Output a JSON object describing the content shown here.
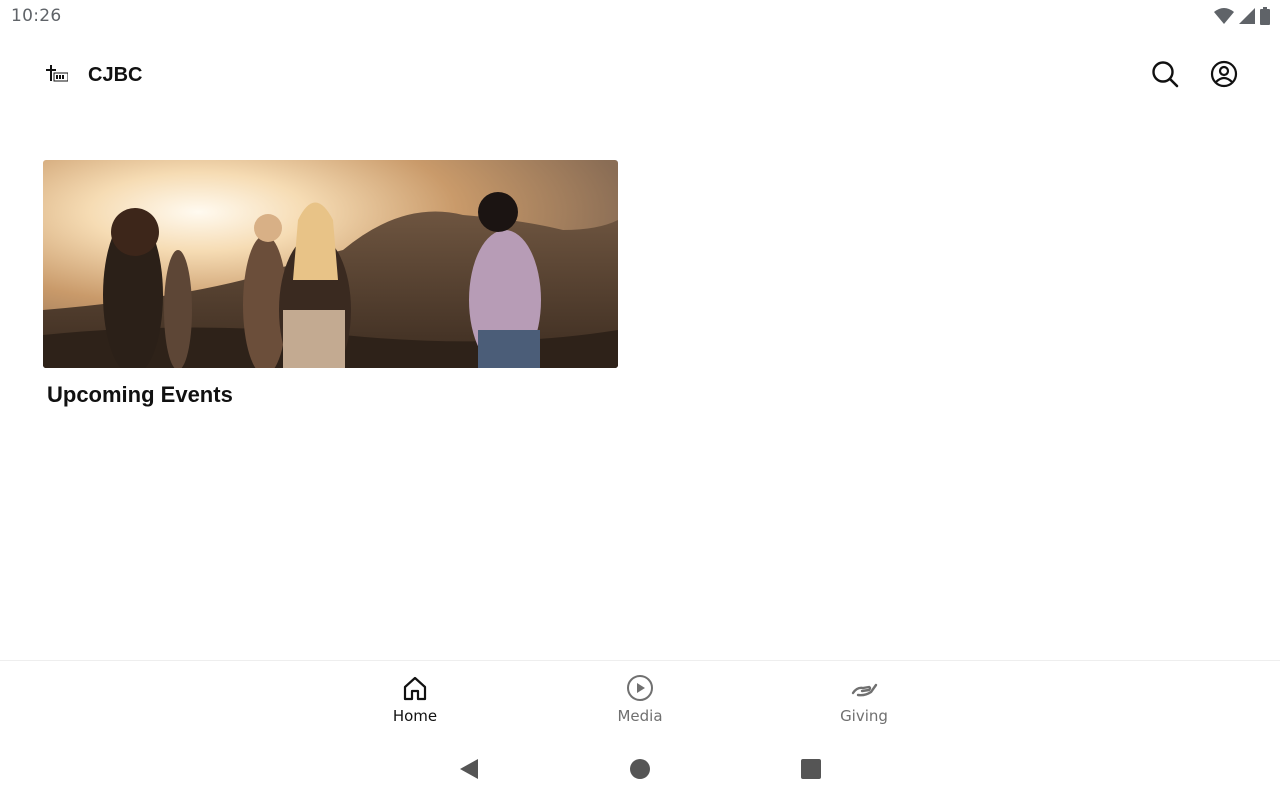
{
  "status_bar": {
    "time": "10:26",
    "icons": [
      "wifi-icon",
      "cell-signal-icon",
      "battery-icon"
    ]
  },
  "app_bar": {
    "title": "CJBC",
    "logo_icon": "cross-logo-icon",
    "actions": [
      "search-icon",
      "account-circle-icon"
    ]
  },
  "main": {
    "cards": [
      {
        "title": "Upcoming Events",
        "image": "group-of-people-at-sunset-photo"
      }
    ]
  },
  "bottom_nav": {
    "items": [
      {
        "label": "Home",
        "icon": "home-icon",
        "selected": true
      },
      {
        "label": "Media",
        "icon": "play-circle-icon",
        "selected": false
      },
      {
        "label": "Giving",
        "icon": "giving-hand-icon",
        "selected": false
      }
    ]
  },
  "system_nav": {
    "buttons": [
      "back-icon",
      "home-circle-icon",
      "recents-square-icon"
    ]
  },
  "colors": {
    "background": "#ffffff",
    "text_primary": "#111111",
    "text_secondary": "#707070",
    "status_text": "#5f6368"
  }
}
